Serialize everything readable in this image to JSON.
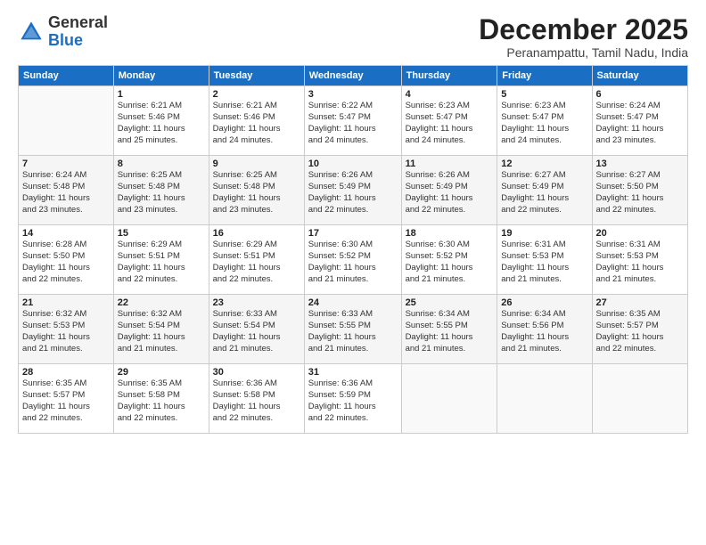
{
  "header": {
    "logo_general": "General",
    "logo_blue": "Blue",
    "month_title": "December 2025",
    "subtitle": "Peranampattu, Tamil Nadu, India"
  },
  "weekdays": [
    "Sunday",
    "Monday",
    "Tuesday",
    "Wednesday",
    "Thursday",
    "Friday",
    "Saturday"
  ],
  "weeks": [
    [
      {
        "day": "",
        "info": ""
      },
      {
        "day": "1",
        "info": "Sunrise: 6:21 AM\nSunset: 5:46 PM\nDaylight: 11 hours\nand 25 minutes."
      },
      {
        "day": "2",
        "info": "Sunrise: 6:21 AM\nSunset: 5:46 PM\nDaylight: 11 hours\nand 24 minutes."
      },
      {
        "day": "3",
        "info": "Sunrise: 6:22 AM\nSunset: 5:47 PM\nDaylight: 11 hours\nand 24 minutes."
      },
      {
        "day": "4",
        "info": "Sunrise: 6:23 AM\nSunset: 5:47 PM\nDaylight: 11 hours\nand 24 minutes."
      },
      {
        "day": "5",
        "info": "Sunrise: 6:23 AM\nSunset: 5:47 PM\nDaylight: 11 hours\nand 24 minutes."
      },
      {
        "day": "6",
        "info": "Sunrise: 6:24 AM\nSunset: 5:47 PM\nDaylight: 11 hours\nand 23 minutes."
      }
    ],
    [
      {
        "day": "7",
        "info": "Sunrise: 6:24 AM\nSunset: 5:48 PM\nDaylight: 11 hours\nand 23 minutes."
      },
      {
        "day": "8",
        "info": "Sunrise: 6:25 AM\nSunset: 5:48 PM\nDaylight: 11 hours\nand 23 minutes."
      },
      {
        "day": "9",
        "info": "Sunrise: 6:25 AM\nSunset: 5:48 PM\nDaylight: 11 hours\nand 23 minutes."
      },
      {
        "day": "10",
        "info": "Sunrise: 6:26 AM\nSunset: 5:49 PM\nDaylight: 11 hours\nand 22 minutes."
      },
      {
        "day": "11",
        "info": "Sunrise: 6:26 AM\nSunset: 5:49 PM\nDaylight: 11 hours\nand 22 minutes."
      },
      {
        "day": "12",
        "info": "Sunrise: 6:27 AM\nSunset: 5:49 PM\nDaylight: 11 hours\nand 22 minutes."
      },
      {
        "day": "13",
        "info": "Sunrise: 6:27 AM\nSunset: 5:50 PM\nDaylight: 11 hours\nand 22 minutes."
      }
    ],
    [
      {
        "day": "14",
        "info": "Sunrise: 6:28 AM\nSunset: 5:50 PM\nDaylight: 11 hours\nand 22 minutes."
      },
      {
        "day": "15",
        "info": "Sunrise: 6:29 AM\nSunset: 5:51 PM\nDaylight: 11 hours\nand 22 minutes."
      },
      {
        "day": "16",
        "info": "Sunrise: 6:29 AM\nSunset: 5:51 PM\nDaylight: 11 hours\nand 22 minutes."
      },
      {
        "day": "17",
        "info": "Sunrise: 6:30 AM\nSunset: 5:52 PM\nDaylight: 11 hours\nand 21 minutes."
      },
      {
        "day": "18",
        "info": "Sunrise: 6:30 AM\nSunset: 5:52 PM\nDaylight: 11 hours\nand 21 minutes."
      },
      {
        "day": "19",
        "info": "Sunrise: 6:31 AM\nSunset: 5:53 PM\nDaylight: 11 hours\nand 21 minutes."
      },
      {
        "day": "20",
        "info": "Sunrise: 6:31 AM\nSunset: 5:53 PM\nDaylight: 11 hours\nand 21 minutes."
      }
    ],
    [
      {
        "day": "21",
        "info": "Sunrise: 6:32 AM\nSunset: 5:53 PM\nDaylight: 11 hours\nand 21 minutes."
      },
      {
        "day": "22",
        "info": "Sunrise: 6:32 AM\nSunset: 5:54 PM\nDaylight: 11 hours\nand 21 minutes."
      },
      {
        "day": "23",
        "info": "Sunrise: 6:33 AM\nSunset: 5:54 PM\nDaylight: 11 hours\nand 21 minutes."
      },
      {
        "day": "24",
        "info": "Sunrise: 6:33 AM\nSunset: 5:55 PM\nDaylight: 11 hours\nand 21 minutes."
      },
      {
        "day": "25",
        "info": "Sunrise: 6:34 AM\nSunset: 5:55 PM\nDaylight: 11 hours\nand 21 minutes."
      },
      {
        "day": "26",
        "info": "Sunrise: 6:34 AM\nSunset: 5:56 PM\nDaylight: 11 hours\nand 21 minutes."
      },
      {
        "day": "27",
        "info": "Sunrise: 6:35 AM\nSunset: 5:57 PM\nDaylight: 11 hours\nand 22 minutes."
      }
    ],
    [
      {
        "day": "28",
        "info": "Sunrise: 6:35 AM\nSunset: 5:57 PM\nDaylight: 11 hours\nand 22 minutes."
      },
      {
        "day": "29",
        "info": "Sunrise: 6:35 AM\nSunset: 5:58 PM\nDaylight: 11 hours\nand 22 minutes."
      },
      {
        "day": "30",
        "info": "Sunrise: 6:36 AM\nSunset: 5:58 PM\nDaylight: 11 hours\nand 22 minutes."
      },
      {
        "day": "31",
        "info": "Sunrise: 6:36 AM\nSunset: 5:59 PM\nDaylight: 11 hours\nand 22 minutes."
      },
      {
        "day": "",
        "info": ""
      },
      {
        "day": "",
        "info": ""
      },
      {
        "day": "",
        "info": ""
      }
    ]
  ]
}
